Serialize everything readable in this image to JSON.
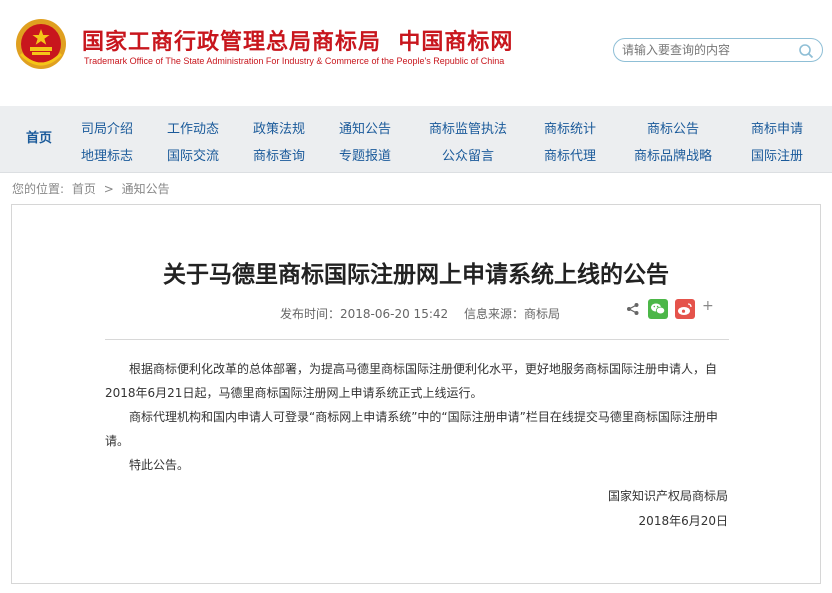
{
  "header": {
    "title": "国家工商行政管理总局商标局  中国商标网",
    "subtitle": "Trademark Office of The State Administration For Industry & Commerce of the People's Republic of China",
    "search_placeholder": "请输入要查询的内容"
  },
  "nav": {
    "home": "首页",
    "columns": [
      [
        "司局介绍",
        "地理标志"
      ],
      [
        "工作动态",
        "国际交流"
      ],
      [
        "政策法规",
        "商标查询"
      ],
      [
        "通知公告",
        "专题报道"
      ],
      [
        "商标监管执法",
        "公众留言"
      ],
      [
        "商标统计",
        "商标代理"
      ],
      [
        "商标公告",
        "商标品牌战略"
      ],
      [
        "商标申请",
        "国际注册"
      ]
    ]
  },
  "breadcrumb": {
    "label": "您的位置:",
    "home": "首页",
    "separator": ">",
    "current": "通知公告"
  },
  "article": {
    "title": "关于马德里商标国际注册网上申请系统上线的公告",
    "publish_time": "发布时间：2018-06-20 15:42",
    "source": "信息来源：商标局",
    "paragraphs": [
      "根据商标便利化改革的总体部署，为提高马德里商标国际注册便利化水平，更好地服务商标国际注册申请人，自2018年6月21日起，马德里商标国际注册网上申请系统正式上线运行。",
      "商标代理机构和国内申请人可登录“商标网上申请系统”中的“国际注册申请”栏目在线提交马德里商标国际注册申请。",
      "特此公告。"
    ],
    "signature_org": "国家知识产权局商标局",
    "signature_date": "2018年6月20日"
  },
  "share": {
    "plus": "+"
  },
  "colors": {
    "brand_red": "#c8161d",
    "nav_blue": "#1a5a9a",
    "wechat_green": "#4cb748",
    "weibo_red": "#e5534b"
  }
}
